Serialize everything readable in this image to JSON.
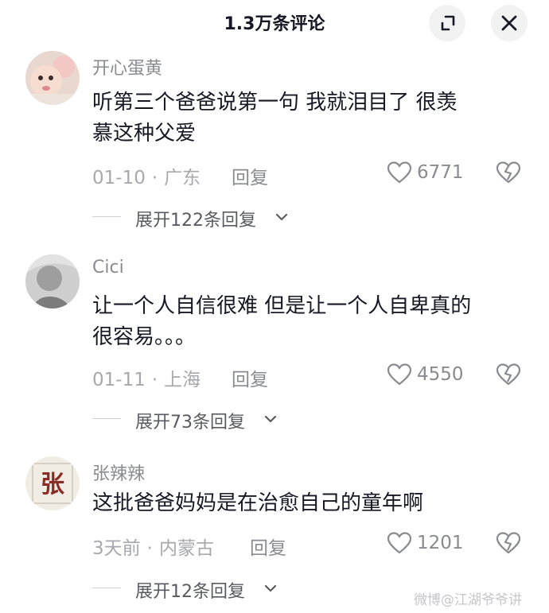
{
  "header": {
    "title": "1.3万条评论",
    "expand_icon": "expand-icon",
    "close_icon": "close-icon"
  },
  "comments": [
    {
      "username": "开心蛋黄",
      "text_line1": "听第三个爸爸说第一句 我就泪目了  很羡",
      "text_line2": "慕这种父爱",
      "date": "01-10",
      "location": "广东",
      "reply": "回复",
      "likes": "6771",
      "expand": "展开122条回复"
    },
    {
      "username": "Cici",
      "text_line1": "让一个人自信很难 但是让一个人自卑真的",
      "text_line2": "很容易。。。",
      "date": "01-11",
      "location": "上海",
      "reply": "回复",
      "likes": "4550",
      "expand": "展开73条回复"
    },
    {
      "username": "张辣辣",
      "avatar_char": "张",
      "text_line1": "这批爸爸妈妈是在治愈自己的童年啊",
      "date": "3天前",
      "location": "内蒙古",
      "reply": "回复",
      "likes": "1201",
      "expand": "展开12条回复"
    }
  ],
  "watermark": "微博@江湖爷爷讲",
  "colors": {
    "text": "#161823",
    "meta": "#a8a9ae",
    "username": "#8a8b91",
    "button_bg": "#f2f2f3"
  }
}
